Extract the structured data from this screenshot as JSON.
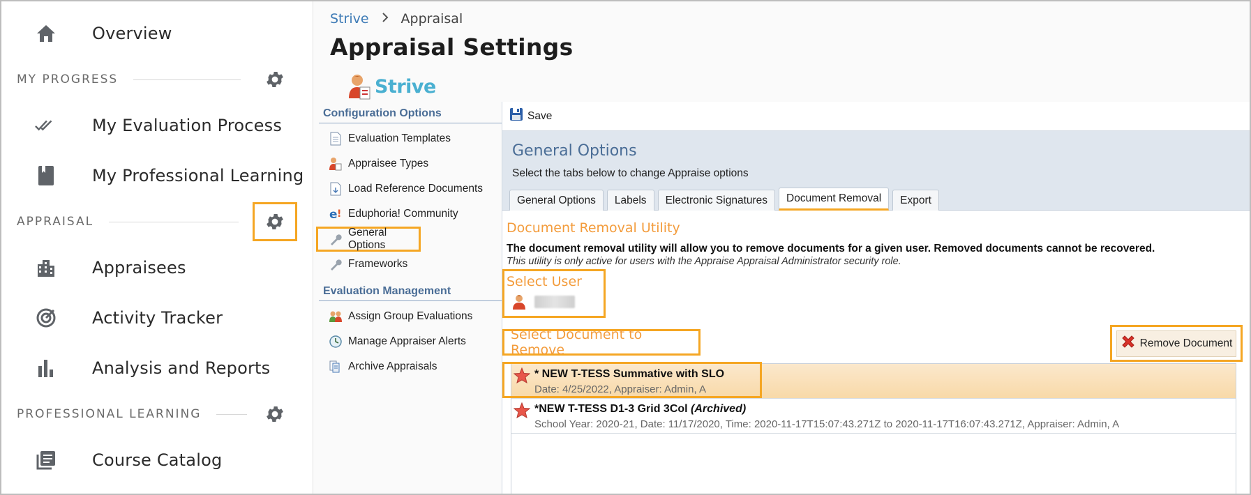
{
  "nav": {
    "overview": "Overview",
    "section_progress": "MY PROGRESS",
    "my_evaluation": "My Evaluation Process",
    "my_learning": "My Professional Learning",
    "section_appraisal": "APPRAISAL",
    "appraisees": "Appraisees",
    "activity_tracker": "Activity Tracker",
    "analysis_reports": "Analysis and Reports",
    "section_learning": "PROFESSIONAL LEARNING",
    "course_catalog": "Course Catalog"
  },
  "breadcrumb": {
    "root": "Strive",
    "separator": ">",
    "current": "Appraisal"
  },
  "page_title": "Appraisal Settings",
  "logo": {
    "word": "Strive"
  },
  "config": {
    "heading": "Configuration Options",
    "items": [
      "Evaluation Templates",
      "Appraisee Types",
      "Load Reference Documents",
      "Eduphoria! Community",
      "General Options",
      "Frameworks"
    ],
    "mgmt_heading": "Evaluation Management",
    "mgmt_items": [
      "Assign Group Evaluations",
      "Manage Appraiser Alerts",
      "Archive Appraisals"
    ]
  },
  "toolbar": {
    "save_label": "Save"
  },
  "options": {
    "title": "General Options",
    "subtitle": "Select the tabs below to change Appraise options",
    "tabs": [
      "General Options",
      "Labels",
      "Electronic Signatures",
      "Document Removal",
      "Export"
    ],
    "active_tab": "Document Removal"
  },
  "removal": {
    "title": "Document Removal Utility",
    "bold_text": "The document removal utility will allow you to remove documents for a given user. Removed documents cannot be recovered.",
    "italic_text": "This utility is only active for users with the Appraise Appraisal Administrator security role.",
    "select_user": "Select User",
    "select_doc": "Select Document to Remove",
    "remove_button": "Remove Document",
    "docs": [
      {
        "title": "* NEW T-TESS Summative with SLO",
        "archived": "",
        "meta": "Date: 4/25/2022, Appraiser: Admin, A"
      },
      {
        "title": "*NEW T-TESS D1-3 Grid 3Col",
        "archived": "(Archived)",
        "meta": "School Year: 2020-21, Date: 11/17/2020, Time: 2020-11-17T15:07:43.271Z to 2020-11-17T16:07:43.271Z, Appraiser: Admin, A"
      }
    ]
  },
  "colors": {
    "highlight": "#f5a623",
    "accent_orange": "#f39c3c",
    "link_blue": "#3e7bb6",
    "heading_blue": "#4a6d96"
  }
}
